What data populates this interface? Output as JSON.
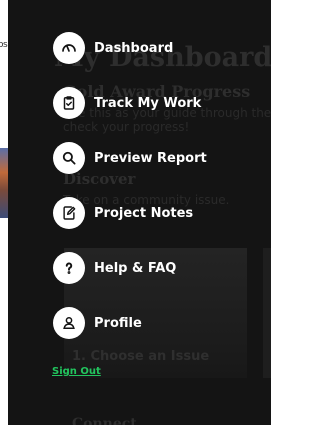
{
  "underlying_page": {
    "left_stub_text": "os",
    "title": "My Dashboard",
    "subtitle": "Gold Award Progress",
    "line1": "Use this as your guide through the",
    "line2": "check your progress!",
    "section": "Discover",
    "section_text": "Take on a community issue.",
    "card_label": "1. Choose an Issue",
    "next_section": "Connect"
  },
  "menu": {
    "items": [
      {
        "label": "Dashboard",
        "icon": "gauge-icon"
      },
      {
        "label": "Track My Work",
        "icon": "clipboard-check-icon"
      },
      {
        "label": "Preview Report",
        "icon": "search-icon"
      },
      {
        "label": "Project Notes",
        "icon": "notes-pencil-icon"
      },
      {
        "label": "Help & FAQ",
        "icon": "question-icon"
      },
      {
        "label": "Profile",
        "icon": "user-icon"
      }
    ],
    "sign_out": "Sign Out"
  },
  "colors": {
    "drawer_bg": "#141414",
    "label": "#ffffff",
    "icon_circle": "#ffffff",
    "sign_out": "#22c55e"
  }
}
